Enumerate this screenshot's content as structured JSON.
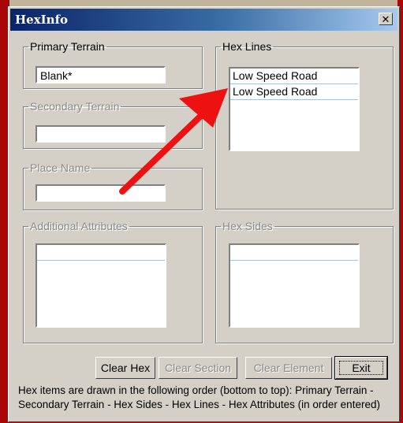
{
  "window": {
    "title": "HexInfo",
    "close_glyph": "✕"
  },
  "groups": {
    "primary_terrain": {
      "label": "Primary Terrain",
      "value": "Blank*"
    },
    "secondary_terrain": {
      "label": "Secondary Terrain",
      "value": ""
    },
    "place_name": {
      "label": "Place Name",
      "value": ""
    },
    "additional_attributes": {
      "label": "Additional Attributes",
      "items": [
        ""
      ]
    },
    "hex_lines": {
      "label": "Hex Lines",
      "items": [
        "Low Speed Road",
        "Low Speed Road"
      ]
    },
    "hex_sides": {
      "label": "Hex Sides",
      "items": [
        ""
      ]
    }
  },
  "buttons": {
    "clear_hex": "Clear Hex",
    "clear_section": "Clear Section",
    "clear_element": "Clear Element",
    "exit": "Exit"
  },
  "footer_text": "Hex items are drawn in the following order (bottom to top):  Primary Terrain - Secondary Terrain - Hex Sides - Hex Lines - Hex Attributes (in order entered)",
  "colors": {
    "annotation_arrow": "#ee1111",
    "titlebar_start": "#0a246a",
    "titlebar_end": "#a6caf0"
  }
}
